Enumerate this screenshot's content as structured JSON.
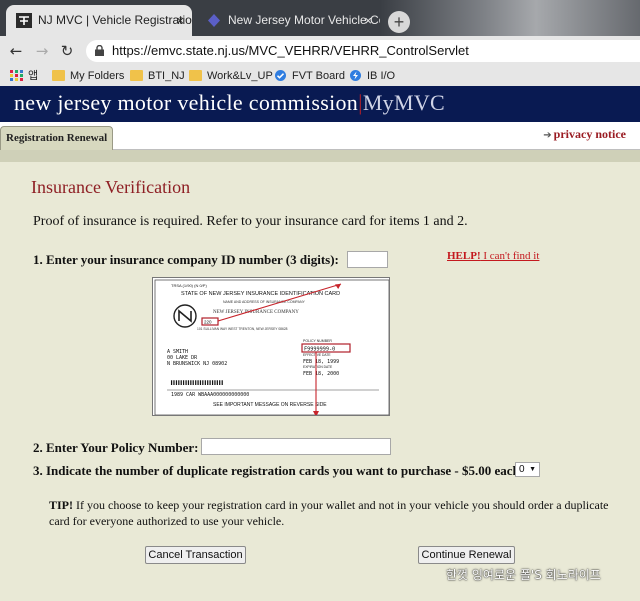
{
  "browser": {
    "tabs": [
      {
        "title": "NJ MVC | Vehicle Registration Re",
        "active": true,
        "close": "×"
      },
      {
        "title": "New Jersey Motor Vehicle Comm",
        "active": false,
        "close": "×"
      }
    ],
    "new_tab": "+",
    "url": "https://emvc.state.nj.us/MVC_VEHRR/VEHRR_ControlServlet",
    "bookmarks": [
      {
        "label": "앱",
        "icon": "apps-grid-icon"
      },
      {
        "label": "My Folders",
        "icon": "folder-icon"
      },
      {
        "label": "BTI_NJ",
        "icon": "folder-icon"
      },
      {
        "label": "Work&Lv_UP",
        "icon": "folder-icon"
      },
      {
        "label": "FVT Board",
        "icon": "check-badge-icon"
      },
      {
        "label": "IB I/O",
        "icon": "bolt-icon"
      }
    ]
  },
  "site": {
    "brand": "new jersey motor vehicle commission",
    "brand_sep": "|",
    "brand_sub": "MyMVC",
    "nav_tab": "Registration Renewal",
    "privacy": "privacy notice"
  },
  "form": {
    "title": "Insurance Verification",
    "intro": "Proof of insurance is required. Refer to your insurance card for items 1 and 2.",
    "item1": {
      "label": "1.  Enter your insurance company ID number (3 digits):",
      "value": ""
    },
    "help": {
      "bold": "HELP!",
      "text": " I can't find it"
    },
    "card": {
      "top_small": "TRSA (1/90) (N 0/P)",
      "heading": "STATE OF NEW JERSEY INSURANCE IDENTIFICATION CARD",
      "company_label": "NAME AND ADDRESS OF INSURANCE COMPANY",
      "company": "NEW JERSEY INSURANCE COMPANY",
      "code": "220",
      "address_line": "101 SULLIVAN WAY      WEST TRENTON, NEW JERSEY 08628",
      "name_lines": [
        "A SMITH",
        "00 LAKE DR",
        "N BRUNSWICK NJ 08902"
      ],
      "policy_label": "POLICY NUMBER",
      "policy": "F9999999-0",
      "effective_label": "EFFECTIVE DATE",
      "effective": "FEB 18, 1999",
      "expiration_label": "EXPIRATION DATE",
      "expiration": "FEB 18, 2000",
      "vehicle": "1989   CAR        WBAAA000000000000",
      "footer": "SEE IMPORTANT MESSAGE ON REVERSE SIDE"
    },
    "item2": {
      "label": "2.  Enter Your Policy Number:",
      "value": ""
    },
    "item3": {
      "label": "3.  Indicate the number of duplicate registration cards you want to purchase - $5.00 each:",
      "selected": "0"
    },
    "tip_bold": "TIP!",
    "tip_text": " If you choose to keep your registration card in your wallet and not in your vehicle you should order a duplicate card for everyone authorized to use your vehicle.",
    "cancel_label": "Cancel Transaction",
    "continue_label": "Continue Renewal"
  },
  "watermark": "한껏 잉여로운 폴'S 회노라이프",
  "colors": {
    "banner": "#091a52",
    "title_red": "#8e1f24",
    "help_red": "#c4191e",
    "page_bg": "#e9e9d6"
  }
}
